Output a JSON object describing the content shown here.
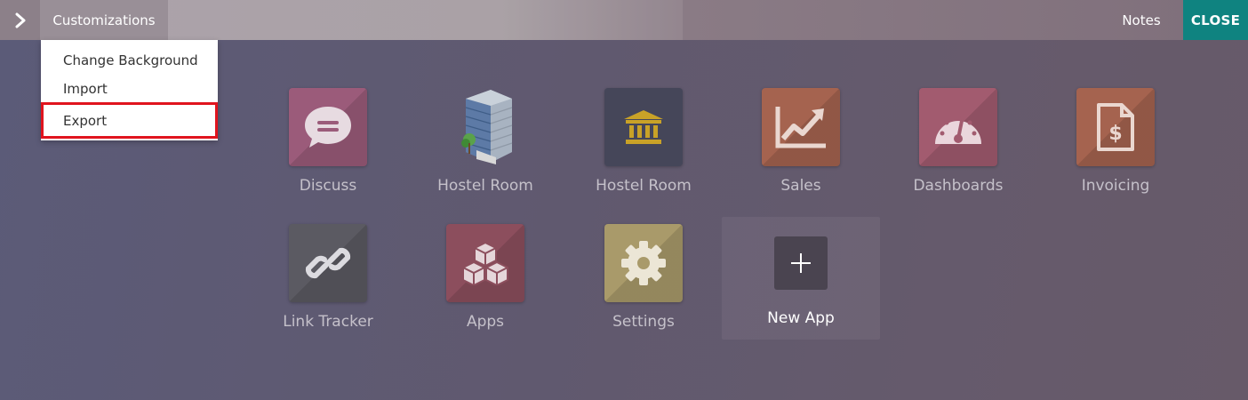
{
  "topbar": {
    "toggle_icon": "chevron-right-icon",
    "customizations_label": "Customizations",
    "notes_label": "Notes",
    "close_label": "CLOSE"
  },
  "dropdown": {
    "items": [
      {
        "label": "Change Background"
      },
      {
        "label": "Import"
      },
      {
        "label": "Export",
        "highlighted": true
      }
    ]
  },
  "apps": [
    {
      "label": "Discuss",
      "icon": "chat-bubble-icon",
      "color": "#9b5b7a"
    },
    {
      "label": "Hostel Room",
      "icon": "building-icon",
      "color": ""
    },
    {
      "label": "Hostel Room",
      "icon": "bank-icon",
      "color": "#454659"
    },
    {
      "label": "Sales",
      "icon": "chart-line-icon",
      "color": "#a5634f"
    },
    {
      "label": "Dashboards",
      "icon": "gauge-icon",
      "color": "#a25b6f"
    },
    {
      "label": "Invoicing",
      "icon": "invoice-dollar-icon",
      "color": "#a5634f"
    },
    {
      "label": "Link Tracker",
      "icon": "link-icon",
      "color": "#5b5a62"
    },
    {
      "label": "Apps",
      "icon": "cubes-icon",
      "color": "#8c4e5d"
    },
    {
      "label": "Settings",
      "icon": "gear-icon",
      "color": "#a99a6a"
    }
  ],
  "new_app": {
    "label": "New App",
    "icon": "plus-icon"
  },
  "colors": {
    "close_button": "#0f8380",
    "export_highlight": "#e0141e",
    "bank_icon_gold": "#c9a227"
  }
}
